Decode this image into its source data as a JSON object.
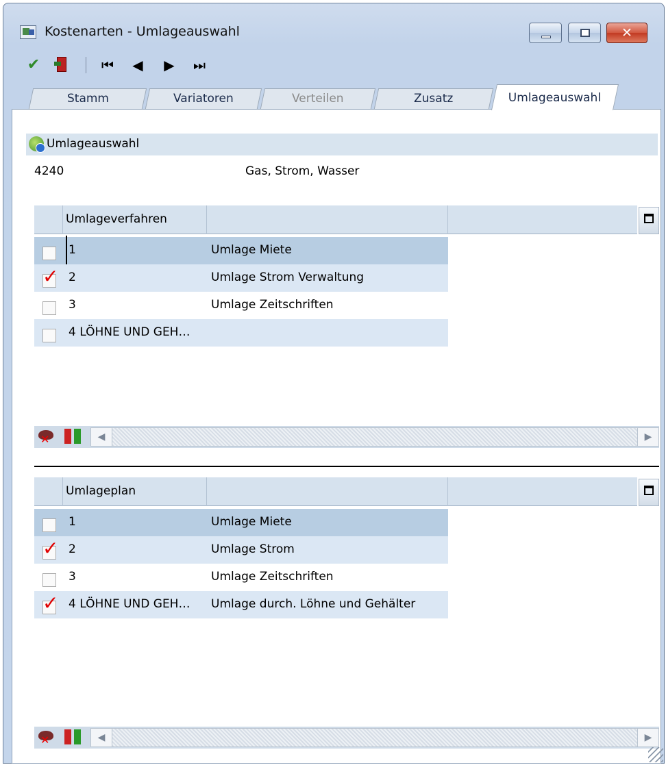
{
  "window": {
    "title": "Kostenarten - Umlageauswahl",
    "close_glyph": "✕"
  },
  "toolbar": {
    "confirm_icon": "checkmark-icon",
    "exit_icon": "exit-door-icon",
    "nav": {
      "first": "⏮",
      "prev": "◀",
      "next": "▶",
      "last": "⏭"
    }
  },
  "tabs": [
    {
      "label": "Stamm",
      "state": "normal"
    },
    {
      "label": "Variatoren",
      "state": "normal"
    },
    {
      "label": "Verteilen",
      "state": "disabled"
    },
    {
      "label": "Zusatz",
      "state": "normal"
    },
    {
      "label": "Umlageauswahl",
      "state": "active"
    }
  ],
  "section": {
    "title": "Umlageauswahl",
    "account_number": "4240",
    "account_name": "Gas, Strom, Wasser"
  },
  "grid_verfahren": {
    "column1": "Umlageverfahren",
    "column2": "",
    "rows": [
      {
        "checked": false,
        "col1": "1",
        "col2": "Umlage Miete"
      },
      {
        "checked": true,
        "col1": "2",
        "col2": "Umlage Strom Verwaltung"
      },
      {
        "checked": false,
        "col1": "3",
        "col2": "Umlage Zeitschriften"
      },
      {
        "checked": false,
        "col1": "4 LÖHNE UND GEH…",
        "col2": ""
      }
    ]
  },
  "grid_plan": {
    "column1": "Umlageplan",
    "column2": "",
    "rows": [
      {
        "checked": false,
        "col1": "1",
        "col2": "Umlage Miete"
      },
      {
        "checked": true,
        "col1": "2",
        "col2": "Umlage Strom"
      },
      {
        "checked": false,
        "col1": "3",
        "col2": "Umlage Zeitschriften"
      },
      {
        "checked": true,
        "col1": "4 LÖHNE UND GEH…",
        "col2": "Umlage durch. Löhne und Gehälter"
      }
    ]
  },
  "scroll": {
    "left_glyph": "◀",
    "right_glyph": "▶"
  },
  "colors": {
    "check_mark": "#e00000",
    "selected_row": "#b7cde2",
    "shaded_row": "#dbe7f4"
  }
}
